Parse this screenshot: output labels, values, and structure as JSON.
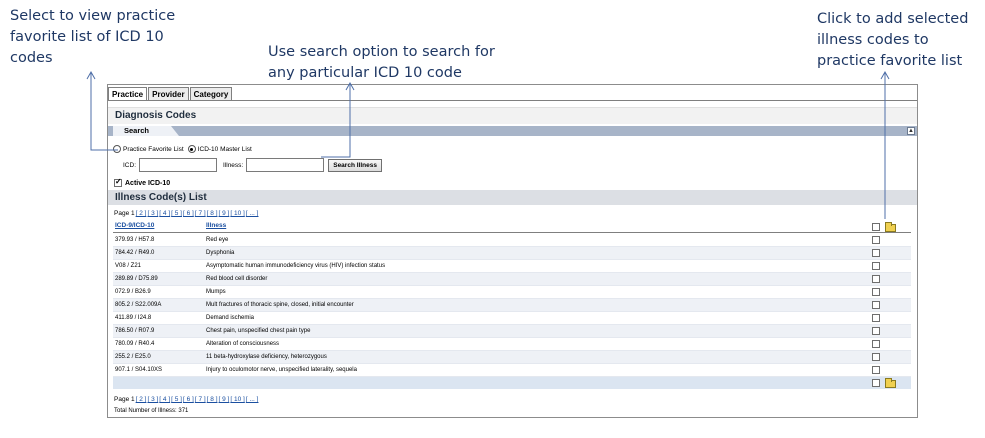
{
  "callouts": {
    "left": "Select to view practice favorite list of ICD 10 codes",
    "middle": "Use search option to search for any particular ICD 10 code",
    "right": "Click to add selected illness codes to practice favorite list"
  },
  "tabs": [
    "Practice",
    "Provider",
    "Category"
  ],
  "panel_title": "Diagnosis Codes",
  "search_tab": "Search",
  "radios": {
    "favorite": "Practice Favorite List",
    "master": "ICD-10 Master List"
  },
  "fields": {
    "icd_label": "ICD:",
    "icd_value": "",
    "illness_label": "Illness:",
    "illness_value": ""
  },
  "search_button": "Search Illness",
  "active_label": "Active ICD-10",
  "list_title": "Illness Code(s) List",
  "pager": {
    "label": "Page 1",
    "links": [
      "[ 2 ]",
      "[ 3 ]",
      "[ 4 ]",
      "[ 5 ]",
      "[ 6 ]",
      "[ 7 ]",
      "[ 8 ]",
      "[ 9 ]",
      "[ 10 ]",
      "[ ... ]"
    ]
  },
  "columns": {
    "code": "ICD-9/ICD-10",
    "illness": "Illness"
  },
  "rows": [
    {
      "code": "379.93 / H57.8",
      "illness": "Red eye"
    },
    {
      "code": "784.42 / R49.0",
      "illness": "Dysphonia"
    },
    {
      "code": "V08 / Z21",
      "illness": "Asymptomatic human immunodeficiency virus (HIV) infection status"
    },
    {
      "code": "289.89 / D75.89",
      "illness": "Red blood cell disorder"
    },
    {
      "code": "072.9 / B26.9",
      "illness": "Mumps"
    },
    {
      "code": "805.2 / S22.009A",
      "illness": "Mult fractures of thoracic spine, closed, initial encounter"
    },
    {
      "code": "411.89 / I24.8",
      "illness": "Demand ischemia"
    },
    {
      "code": "786.50 / R07.9",
      "illness": "Chest pain, unspecified chest pain type"
    },
    {
      "code": "780.09 / R40.4",
      "illness": "Alteration of consciousness"
    },
    {
      "code": "255.2 / E25.0",
      "illness": "11 beta-hydroxylase deficiency, heterozygous"
    },
    {
      "code": "907.1 / S04.10XS",
      "illness": "Injury to oculomotor nerve, unspecified laterality, sequela"
    }
  ],
  "total": "Total Number of Illness: 371",
  "colors": {
    "callout_text": "#1f3864",
    "arrow": "#4f6fa8",
    "search_bar": "#a7b4c8",
    "link": "#1a4fa0"
  }
}
